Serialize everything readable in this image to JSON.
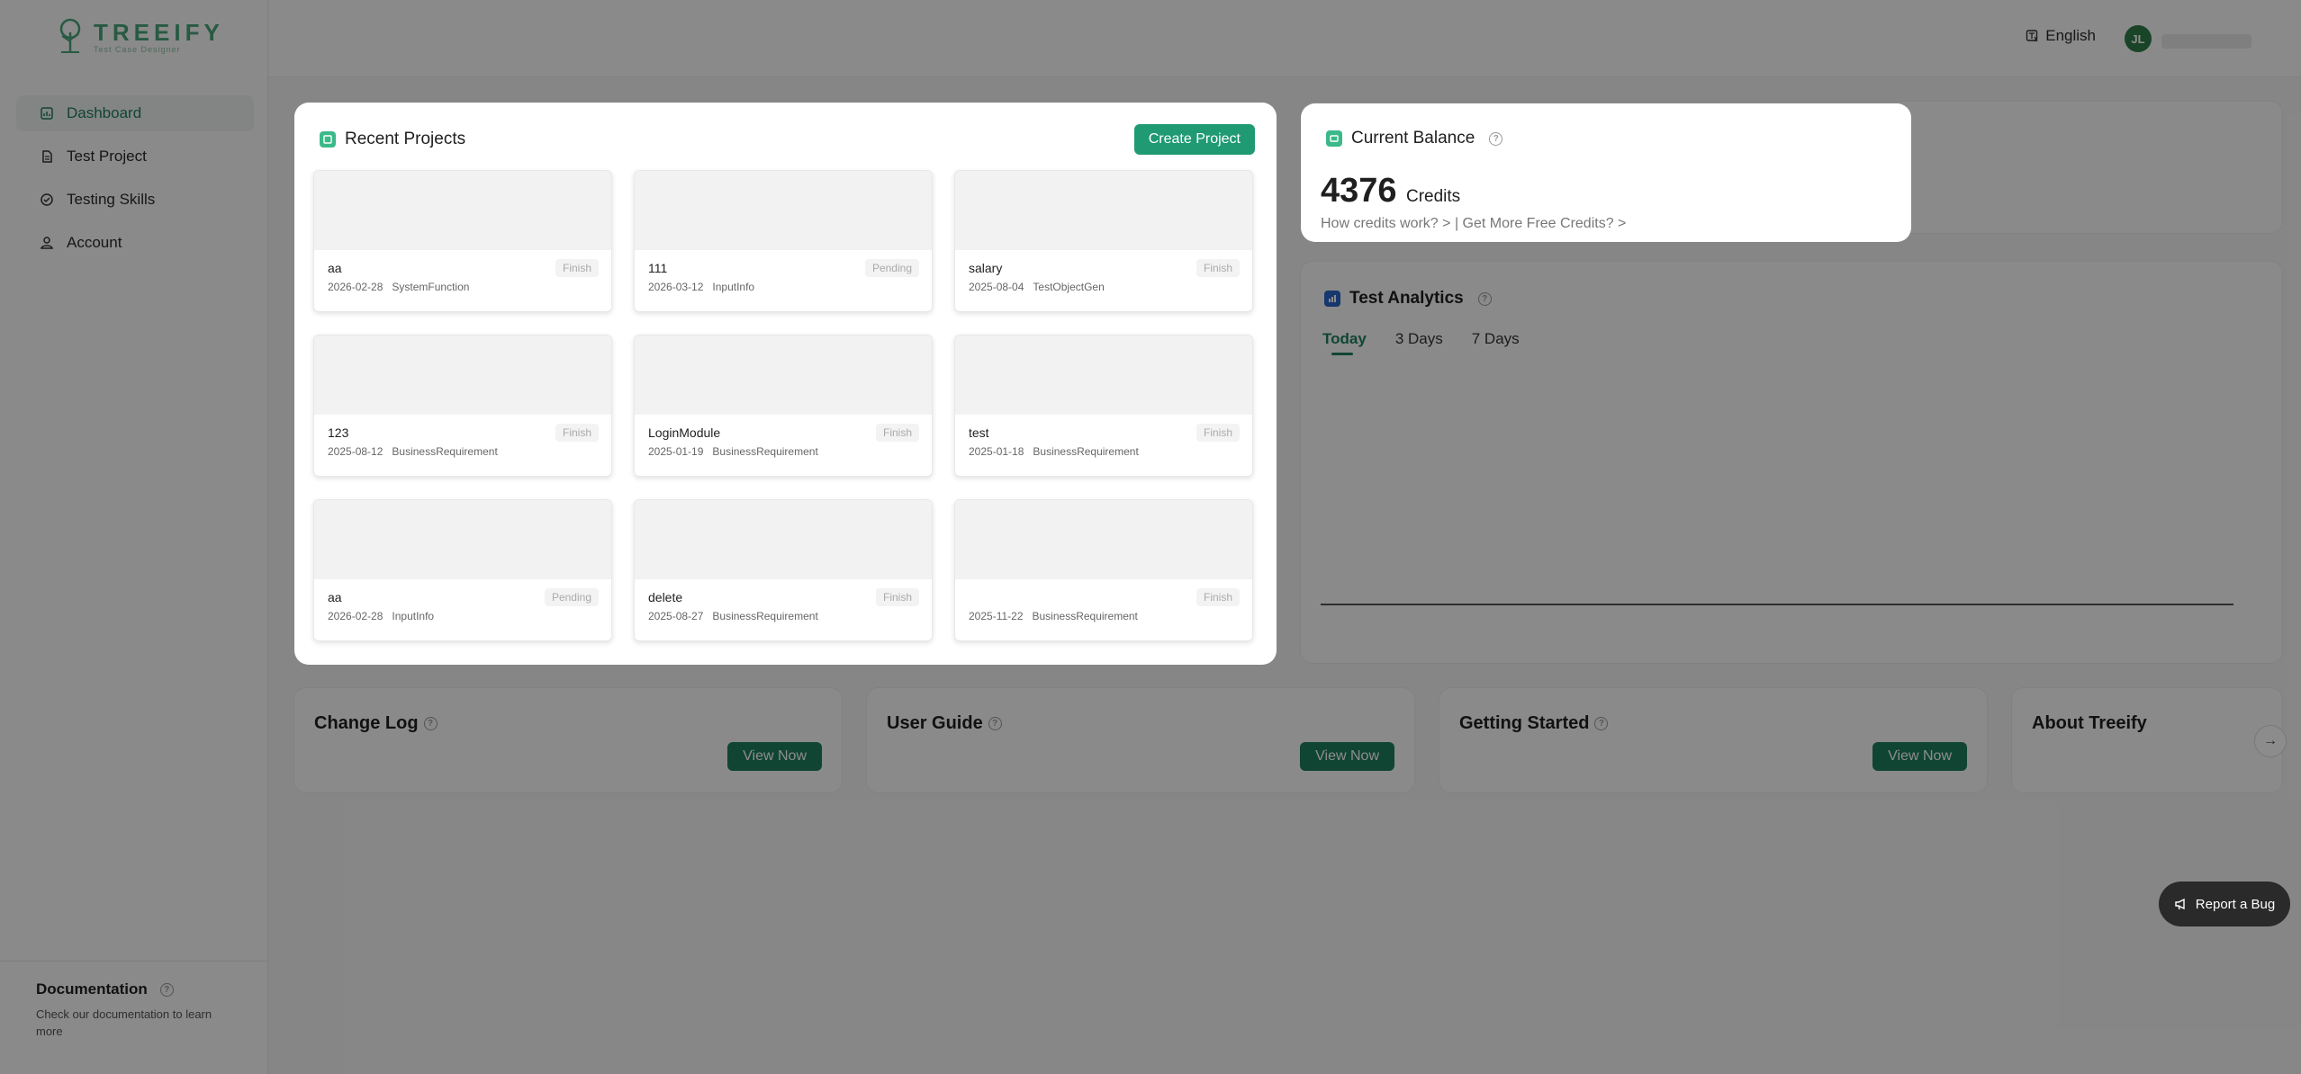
{
  "brand": {
    "name": "TREEIFY",
    "tagline": "Test Case Designer"
  },
  "sidebar": {
    "items": [
      {
        "label": "Dashboard",
        "active": true
      },
      {
        "label": "Test Project"
      },
      {
        "label": "Testing Skills"
      },
      {
        "label": "Account"
      }
    ],
    "doc_title": "Documentation",
    "doc_desc": "Check our documentation to learn more"
  },
  "header": {
    "language": "English",
    "avatar_initials": "JL"
  },
  "recent": {
    "title": "Recent Projects",
    "create_label": "Create Project",
    "projects": [
      {
        "name": "aa",
        "date": "2026-02-28",
        "type": "SystemFunction",
        "status": "Finish"
      },
      {
        "name": "111",
        "date": "2026-03-12",
        "type": "InputInfo",
        "status": "Pending"
      },
      {
        "name": "salary",
        "date": "2025-08-04",
        "type": "TestObjectGen",
        "status": "Finish"
      },
      {
        "name": "123",
        "date": "2025-08-12",
        "type": "BusinessRequirement",
        "status": "Finish"
      },
      {
        "name": "LoginModule",
        "date": "2025-01-19",
        "type": "BusinessRequirement",
        "status": "Finish"
      },
      {
        "name": "test",
        "date": "2025-01-18",
        "type": "BusinessRequirement",
        "status": "Finish"
      },
      {
        "name": "aa",
        "date": "2026-02-28",
        "type": "InputInfo",
        "status": "Pending"
      },
      {
        "name": "delete",
        "date": "2025-08-27",
        "type": "BusinessRequirement",
        "status": "Finish"
      },
      {
        "name": "",
        "date": "2025-11-22",
        "type": "BusinessRequirement",
        "status": "Finish"
      }
    ]
  },
  "balance": {
    "title": "Current Balance",
    "amount": "4376",
    "unit": "Credits",
    "link1": "How credits work?",
    "link2": "| Get More Free Credits?"
  },
  "analytics": {
    "title": "Test Analytics",
    "tabs": [
      "Today",
      "3 Days",
      "7 Days"
    ]
  },
  "panels": [
    {
      "title": "Change Log",
      "button": "View Now"
    },
    {
      "title": "User Guide",
      "button": "View Now"
    },
    {
      "title": "Getting Started",
      "button": "View Now"
    },
    {
      "title": "About Treeify"
    }
  ],
  "report_bug": "Report a Bug",
  "colors": {
    "accent": "#1e7e5e",
    "button": "#1f9a72"
  }
}
